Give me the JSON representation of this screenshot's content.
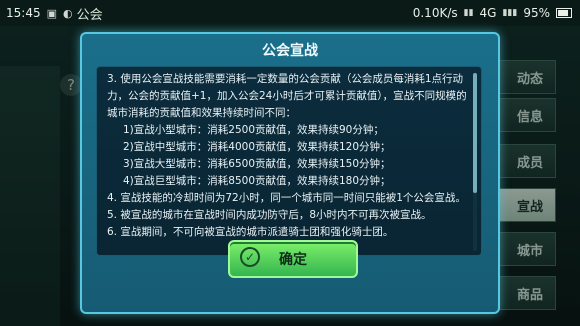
{
  "status_bar": {
    "time": "15:45",
    "app_title": "公会",
    "network_speed": "0.10K/s",
    "signal_label": "4G",
    "battery": "95%"
  },
  "background": {
    "side_tabs": [
      "动态",
      "信息",
      "成员",
      "宣战",
      "城市",
      "商品"
    ],
    "help_icon": "?"
  },
  "modal": {
    "title": "公会宣战",
    "paragraph3": "3. 使用公会宣战技能需要消耗一定数量的公会贡献（公会成员每消耗1点行动力，公会的贡献值+1，加入公会24小时后才可累计贡献值），宣战不同规模的城市消耗的贡献值和效果持续时间不同：",
    "list": [
      "1)宣战小型城市：消耗2500贡献值，效果持续90分钟；",
      "2)宣战中型城市：消耗4000贡献值，效果持续120分钟；",
      "3)宣战大型城市：消耗6500贡献值，效果持续150分钟；",
      "4)宣战巨型城市：消耗8500贡献值，效果持续180分钟；"
    ],
    "paragraph4": "4. 宣战技能的冷却时间为72小时，同一个城市同一时间只能被1个公会宣战。",
    "paragraph5": "5. 被宣战的城市在宣战时间内成功防守后，8小时内不可再次被宣战。",
    "paragraph6": "6. 宣战期间，不可向被宣战的城市派遣骑士团和强化骑士团。",
    "ok_label": "确定",
    "ok_icon": "chevron-down-circle-icon"
  }
}
